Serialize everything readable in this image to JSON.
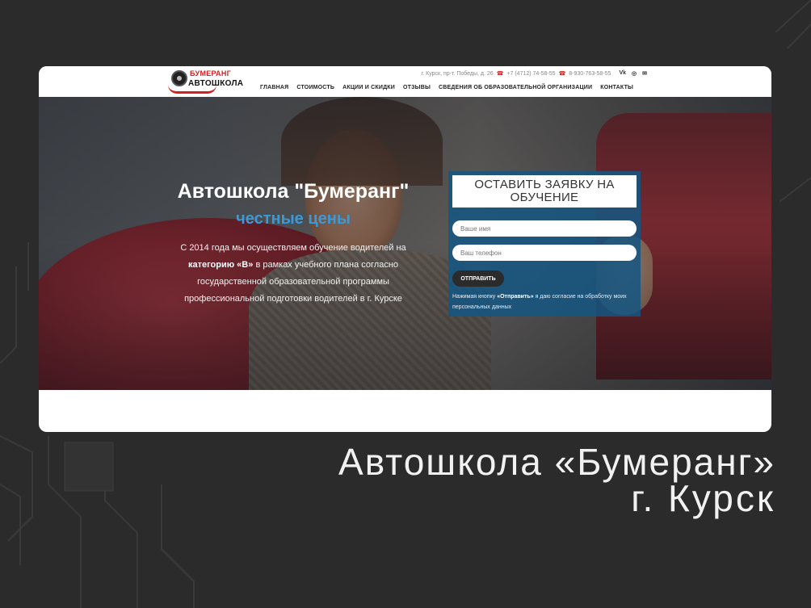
{
  "colors": {
    "background": "#2b2b2b",
    "accent_red": "#d32020",
    "accent_blue": "#3a9ad9",
    "form_blue": "#145682"
  },
  "header": {
    "logo": {
      "top": "БУМЕРАНГ",
      "bottom": "АВТОШКОЛА"
    },
    "address": "г. Курск, пр-т. Победы, д. 26",
    "phone1": "+7 (4712) 74-58-55",
    "phone2": "8-930-763-58-55",
    "social": [
      "vk-icon",
      "instagram-icon",
      "mail-icon"
    ],
    "social_labels": {
      "vk": "Vk",
      "instagram": "◎",
      "mail": "✉"
    },
    "nav": [
      "ГЛАВНАЯ",
      "СТОИМОСТЬ",
      "АКЦИИ И СКИДКИ",
      "ОТЗЫВЫ",
      "СВЕДЕНИЯ ОБ ОБРАЗОВАТЕЛЬНОЙ ОРГАНИЗАЦИИ",
      "КОНТАКТЫ"
    ]
  },
  "hero": {
    "title": "Автошкола \"Бумеранг\"",
    "subtitle": "честные цены",
    "text_1": "С 2014 года мы осуществляем обучение водителей на",
    "text_bold": "категорию «В»",
    "text_2": "в рамках учебного плана согласно государственной образовательной программы профессиональной подготовки водителей в г. Курске"
  },
  "form": {
    "title": "ОСТАВИТЬ ЗАЯВКУ НА ОБУЧЕНИЕ",
    "name_placeholder": "Ваше имя",
    "phone_placeholder": "Ваш телефон",
    "submit": "ОТПРАВИТЬ",
    "consent_1": "Нажимая кнопку",
    "consent_bold": "«Отправить»",
    "consent_2": "я даю согласие на обработку моих персональных данных"
  },
  "caption": {
    "line1": "Автошкола «Бумеранг»",
    "line2": "г. Курск"
  }
}
